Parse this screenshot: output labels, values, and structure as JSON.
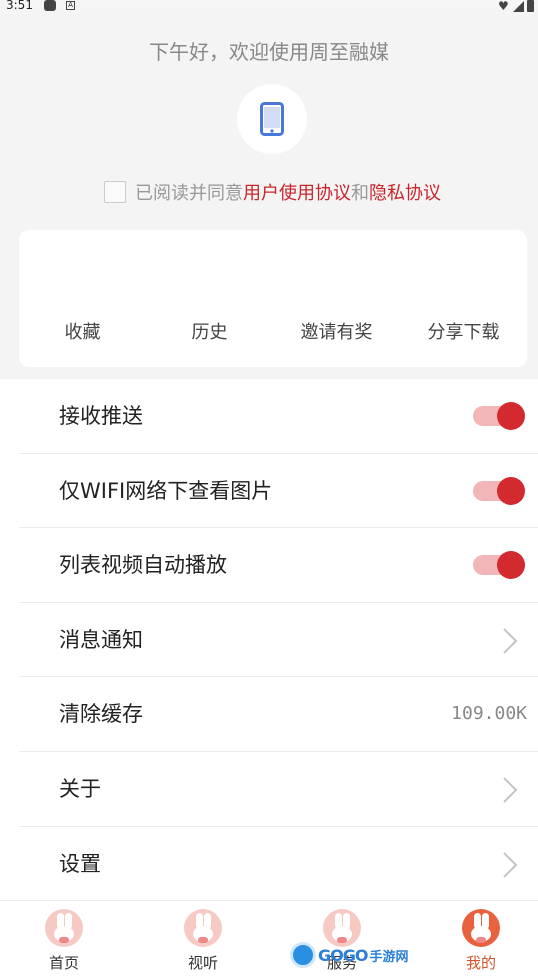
{
  "status_bar": {
    "time": "3:51",
    "badge": "A"
  },
  "header": {
    "greeting": "下午好，欢迎使用周至融媒",
    "login_icon": "phone-icon",
    "agreement": {
      "prefix": "已阅读并同意",
      "user_agreement": "用户使用协议",
      "conjunction": "和",
      "privacy_policy": "隐私协议"
    }
  },
  "quick_actions": [
    "收藏",
    "历史",
    "邀请有奖",
    "分享下载"
  ],
  "settings": {
    "push": {
      "label": "接收推送",
      "enabled": true
    },
    "wifi_images": {
      "label": "仅WIFI网络下查看图片",
      "enabled": true
    },
    "autoplay": {
      "label": "列表视频自动播放",
      "enabled": true
    },
    "notifications": {
      "label": "消息通知"
    },
    "clear_cache": {
      "label": "清除缓存",
      "value": "109.00K"
    },
    "about": {
      "label": "关于"
    },
    "preferences": {
      "label": "设置"
    }
  },
  "tabbar": {
    "tabs": [
      {
        "label": "首页",
        "icon": "rabbit-mascot-icon"
      },
      {
        "label": "视听",
        "icon": "rabbit-mascot-icon"
      },
      {
        "label": "服务",
        "icon": "rabbit-mascot-icon"
      },
      {
        "label": "我的",
        "icon": "rabbit-mascot-icon"
      }
    ],
    "active_index": 3
  },
  "watermark": {
    "brand": "GOGO",
    "text": "手游网"
  },
  "colors": {
    "accent": "#c8252c",
    "toggle_on": "#d22a2f",
    "active_tab": "#d2562a",
    "header_bg": "#f4f4f4"
  }
}
